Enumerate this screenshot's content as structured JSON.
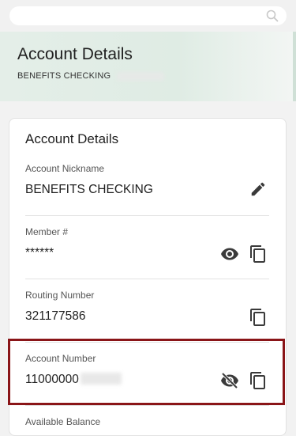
{
  "search": {
    "placeholder": "",
    "icon": "search-icon"
  },
  "header": {
    "title": "Account Details",
    "account_name": "BENEFITS CHECKING"
  },
  "card": {
    "title": "Account Details",
    "rows": [
      {
        "label": "Account Nickname",
        "value": "BENEFITS CHECKING",
        "actions": [
          "edit-icon"
        ]
      },
      {
        "label": "Member #",
        "value": "******",
        "actions": [
          "eye-icon",
          "copy-icon"
        ]
      },
      {
        "label": "Routing Number",
        "value": "321177586",
        "actions": [
          "copy-icon"
        ]
      },
      {
        "label": "Account Number",
        "value": "11000000",
        "value_masked_suffix": true,
        "actions": [
          "eye-off-icon",
          "copy-icon"
        ],
        "highlighted": true
      }
    ],
    "partial_label": "Available Balance"
  },
  "colors": {
    "highlight": "#8a1518",
    "header_gradient_start": "#e4eee8",
    "icon": "#555555"
  }
}
